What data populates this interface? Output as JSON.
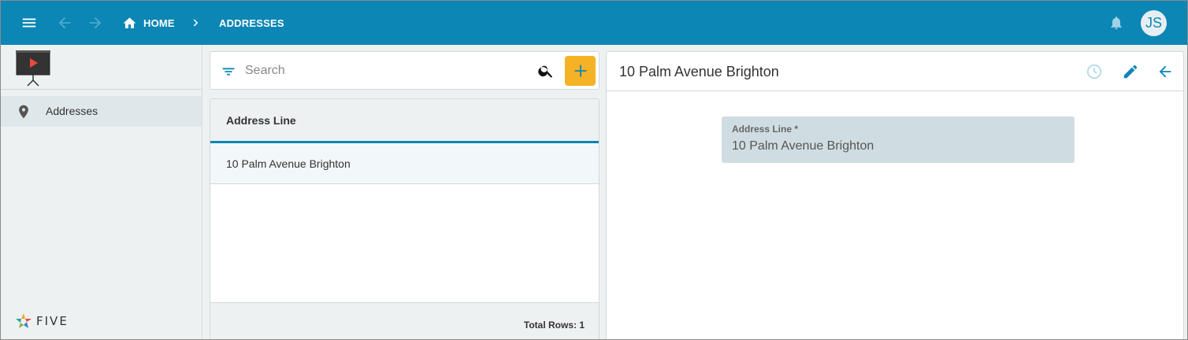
{
  "topbar": {
    "menu_icon": "hamburger-menu-icon",
    "back_icon": "arrow-back-icon",
    "forward_icon": "arrow-forward-icon",
    "breadcrumb": {
      "home_label": "HOME",
      "separator_icon": "chevron-right-icon",
      "current_label": "ADDRESSES"
    },
    "notifications_icon": "bell-icon",
    "avatar_initials": "JS"
  },
  "sidebar": {
    "app_logo_icon": "presentation-screen-icon",
    "items": [
      {
        "label": "Addresses",
        "icon": "location-pin-icon",
        "selected": true
      }
    ],
    "footer_logo_text": "FIVE"
  },
  "list": {
    "search": {
      "placeholder": "Search",
      "value": ""
    },
    "add_button_icon": "plus-icon",
    "columns": [
      "Address Line"
    ],
    "rows": [
      {
        "address_line": "10 Palm Avenue Brighton"
      }
    ],
    "footer": {
      "total_rows_text": "Total Rows: 1"
    }
  },
  "detail": {
    "title": "10 Palm Avenue Brighton",
    "actions": [
      "history-icon",
      "edit-pencil-icon",
      "arrow-back-icon"
    ],
    "fields": [
      {
        "label": "Address Line *",
        "value": "10 Palm Avenue Brighton"
      }
    ]
  },
  "colors": {
    "topbar": "#0b86b5",
    "accent_button": "#f5b225",
    "field_background": "#cfdde2",
    "sidebar_background": "#eef1f2"
  }
}
